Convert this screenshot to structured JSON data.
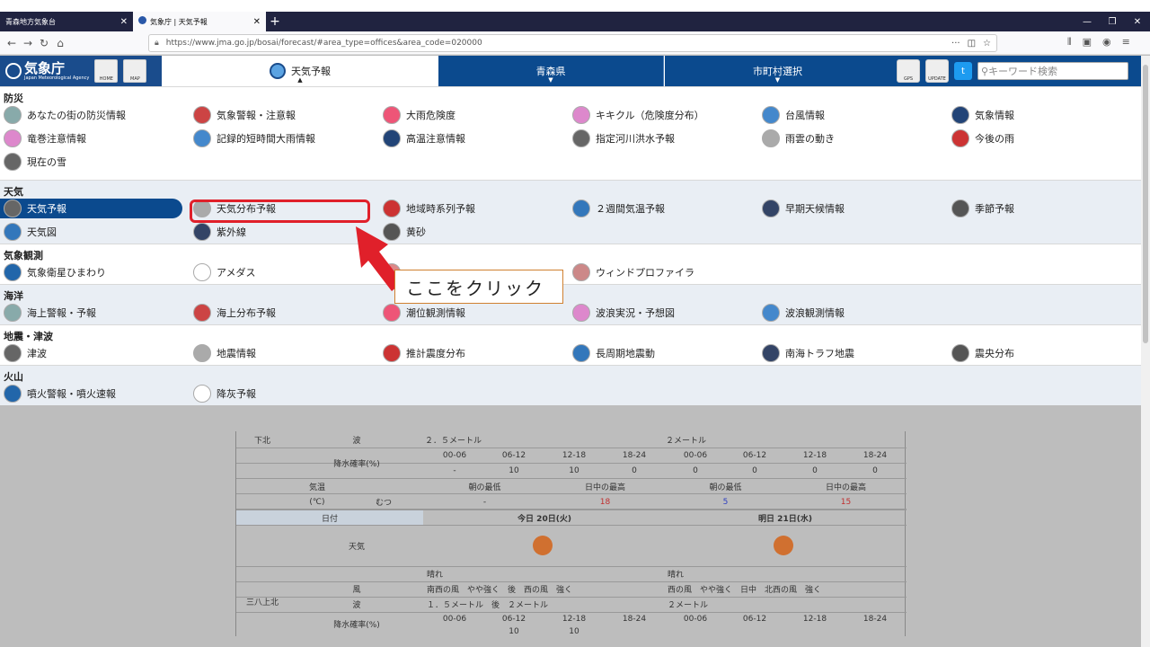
{
  "browser": {
    "tabs": [
      {
        "label": "青森地方気象台",
        "active": false
      },
      {
        "label": "気象庁 | 天気予報",
        "active": true
      }
    ],
    "new_tab": "+",
    "url": "https://www.jma.go.jp/bosai/forecast/#area_type=offices&area_code=020000"
  },
  "header": {
    "logo": "気象庁",
    "logo_sub": "Japan Meteorological Agency",
    "home": "HOME",
    "map": "MAP",
    "nav": [
      "天気予報",
      "青森県",
      "市町村選択"
    ],
    "gps": "GPS",
    "update": "UPDATE",
    "search_placeholder": "キーワード検索"
  },
  "menu": [
    {
      "title": "防災",
      "rows": [
        [
          "あなたの街の防災情報",
          "気象警報・注意報",
          "大雨危険度",
          "キキクル（危険度分布）",
          "台風情報",
          "気象情報"
        ],
        [
          "竜巻注意情報",
          "記録的短時間大雨情報",
          "高温注意情報",
          "指定河川洪水予報",
          "雨雲の動き",
          "今後の雨"
        ],
        [
          "現在の雪"
        ]
      ]
    },
    {
      "title": "天気",
      "rows": [
        [
          "天気予報",
          "天気分布予報",
          "地域時系列予報",
          "２週間気温予報",
          "早期天候情報",
          "季節予報"
        ],
        [
          "天気図",
          "紫外線",
          "黄砂"
        ]
      ]
    },
    {
      "title": "気象観測",
      "rows": [
        [
          "気象衛星ひまわり",
          "アメダス",
          "",
          "ウィンドプロファイラ"
        ]
      ]
    },
    {
      "title": "海洋",
      "rows": [
        [
          "海上警報・予報",
          "海上分布予報",
          "潮位観測情報",
          "波浪実況・予想図",
          "波浪観測情報"
        ]
      ]
    },
    {
      "title": "地震・津波",
      "rows": [
        [
          "津波",
          "地震情報",
          "推計震度分布",
          "長周期地震動",
          "南海トラフ地震",
          "震央分布"
        ]
      ]
    },
    {
      "title": "火山",
      "rows": [
        [
          "噴火警報・噴火速報",
          "降灰予報"
        ]
      ]
    }
  ],
  "annotation": {
    "callout": "ここをクリック"
  },
  "forecast": {
    "area1": "下北",
    "wave_label": "波",
    "wave1_today": "２．５メートル",
    "wave1_tomorrow": "２メートル",
    "rain_label": "降水確率(%)",
    "times": [
      "00-06",
      "06-12",
      "12-18",
      "18-24",
      "00-06",
      "06-12",
      "12-18",
      "18-24"
    ],
    "rain1": [
      "-",
      "10",
      "10",
      "0",
      "0",
      "0",
      "0",
      "0"
    ],
    "temp_label": "気温",
    "temp_unit": "(℃)",
    "city": "むつ",
    "min_label": "朝の最低",
    "max_label": "日中の最高",
    "temps": [
      "-",
      "18",
      "5",
      "15"
    ],
    "date_label": "日付",
    "today": "今日 20日(火)",
    "tomorrow": "明日 21日(水)",
    "weather_label": "天気",
    "area2": "三八上北",
    "w_today": "晴れ",
    "w_tomorrow": "晴れ",
    "wind_label": "風",
    "wind_today": "南西の風　やや強く　後　西の風　強く",
    "wind_tomorrow": "西の風　やや強く　日中　北西の風　強く",
    "wave2_today": "１．５メートル　後　２メートル",
    "wave2_tomorrow": "２メートル",
    "rain2": [
      "",
      "10",
      "10",
      "",
      "",
      "",
      "",
      ""
    ]
  }
}
